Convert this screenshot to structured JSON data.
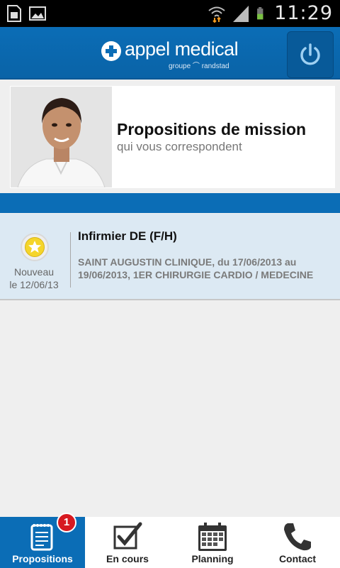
{
  "status_bar": {
    "time": "11:29",
    "icons": [
      "sim-card-icon",
      "image-icon",
      "wifi-icon",
      "signal-icon",
      "battery-icon"
    ]
  },
  "header": {
    "brand": "appel medical",
    "group_tagline": "groupe ⌒ randstad",
    "power_icon": "power-icon",
    "accent_color": "#0b6db6"
  },
  "banner": {
    "title": "Propositions de mission",
    "subtitle": "qui vous correspondent"
  },
  "missions": [
    {
      "badge_icon": "star-icon",
      "status": "Nouveau",
      "date": "le 12/06/13",
      "title": "Infirmier DE (F/H)",
      "description": "SAINT AUGUSTIN CLINIQUE, du 17/06/2013 au 19/06/2013, 1ER CHIRURGIE CARDIO / MEDECINE"
    }
  ],
  "tabs": [
    {
      "label": "Propositions",
      "icon": "clipboard-icon",
      "active": true,
      "badge": "1"
    },
    {
      "label": "En cours",
      "icon": "checkbox-icon",
      "active": false
    },
    {
      "label": "Planning",
      "icon": "calendar-icon",
      "active": false
    },
    {
      "label": "Contact",
      "icon": "phone-icon",
      "active": false
    }
  ]
}
